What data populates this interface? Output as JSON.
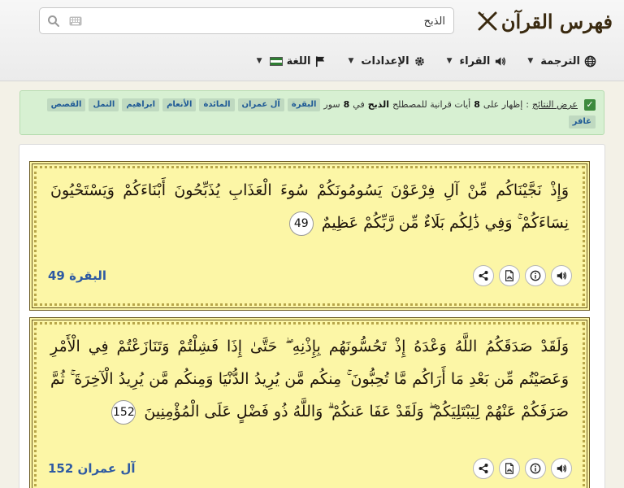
{
  "brand": {
    "title": "فهرس القرآن"
  },
  "search": {
    "value": "الذبح",
    "placeholder": ""
  },
  "menu": {
    "translation": "الترجمة",
    "readers": "القراء",
    "settings": "الإعدادات",
    "language": "اللغة"
  },
  "info": {
    "results_link": "عرض النتائج",
    "sep": ":",
    "text_a": "إظهار على",
    "count_ayat": "8",
    "text_b": "أيات قرانية للمصطلح",
    "term": "الذبح",
    "text_c": "في",
    "count_surahs": "8",
    "text_d": "سور",
    "surahs": [
      "البقرة",
      "آل عمران",
      "المائدة",
      "الأنعام",
      "ابراهيم",
      "النمل",
      "القصص",
      "غافر"
    ]
  },
  "verses": [
    {
      "text": "وَإِذْ نَجَّيْنَاكُم مِّنْ آلِ فِرْعَوْنَ يَسُومُونَكُمْ سُوءَ الْعَذَابِ يُذَبِّحُونَ أَبْنَاءَكُمْ وَيَسْتَحْيُونَ نِسَاءَكُمْ ۚ وَفِي ذَٰلِكُم بَلَاءٌ مِّن رَّبِّكُمْ عَظِيمٌ",
      "number": "49",
      "ref": "البقرة 49"
    },
    {
      "text": "وَلَقَدْ صَدَقَكُمُ اللَّهُ وَعْدَهُ إِذْ تَحُسُّونَهُم بِإِذْنِهِ ۖ حَتَّىٰ إِذَا فَشِلْتُمْ وَتَنَازَعْتُمْ فِي الْأَمْرِ وَعَصَيْتُم مِّن بَعْدِ مَا أَرَاكُم مَّا تُحِبُّونَ ۚ مِنكُم مَّن يُرِيدُ الدُّنْيَا وَمِنكُم مَّن يُرِيدُ الْآخِرَةَ ۚ ثُمَّ صَرَفَكُمْ عَنْهُمْ لِيَبْتَلِيَكُمْ ۖ وَلَقَدْ عَفَا عَنكُمْ ۗ وَاللَّهُ ذُو فَضْلٍ عَلَى الْمُؤْمِنِينَ",
      "number": "152",
      "ref": "آل عمران 152"
    }
  ],
  "colors": {
    "verse_bg": "#fcf6a6",
    "ref_text": "#2e5aa3",
    "info_bg": "#d7f0d2",
    "tag_text": "#1f5a96"
  },
  "icons": [
    "quill-icon",
    "search-icon",
    "keyboard-icon",
    "globe-icon",
    "speaker-icon",
    "gear-icon",
    "flag-icon",
    "share-icon",
    "pdf-icon",
    "info-icon",
    "audio-icon",
    "check-icon"
  ]
}
